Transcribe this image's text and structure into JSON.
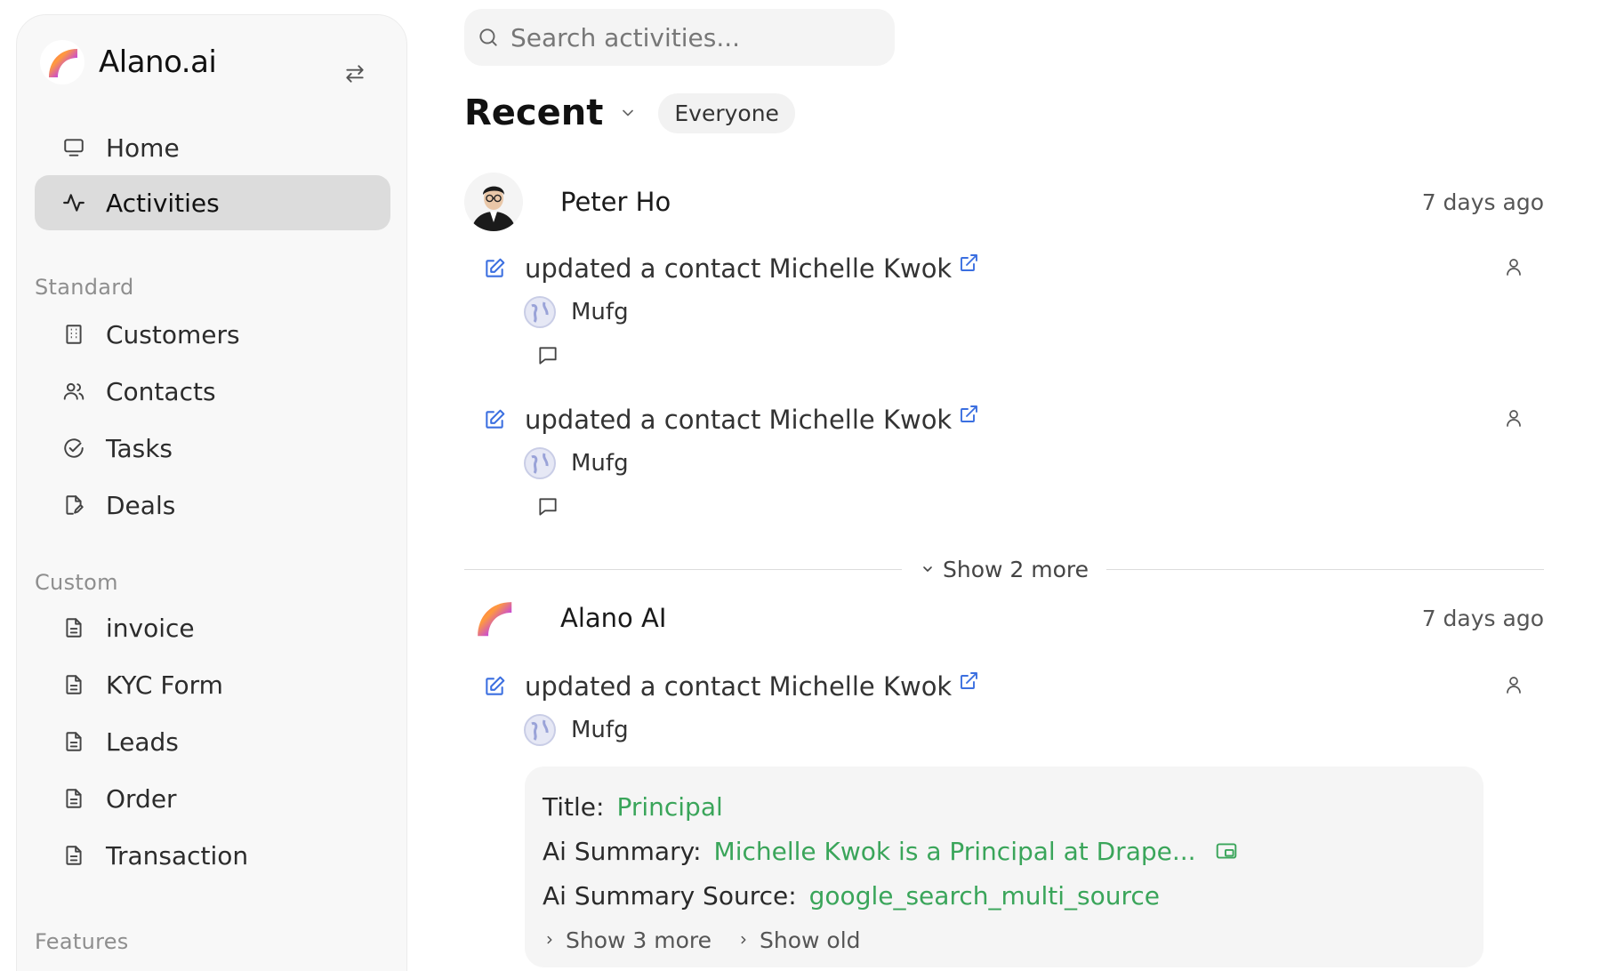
{
  "sidebar": {
    "brand": "Alano.ai",
    "nav": [
      {
        "label": "Home",
        "icon": "monitor-icon"
      },
      {
        "label": "Activities",
        "icon": "activity-icon",
        "active": true
      }
    ],
    "standard_label": "Standard",
    "standard": [
      {
        "label": "Customers",
        "icon": "building-icon"
      },
      {
        "label": "Contacts",
        "icon": "users-icon"
      },
      {
        "label": "Tasks",
        "icon": "check-circle-icon"
      },
      {
        "label": "Deals",
        "icon": "file-edit-icon"
      }
    ],
    "custom_label": "Custom",
    "custom": [
      {
        "label": "invoice",
        "icon": "document-icon"
      },
      {
        "label": "KYC Form",
        "icon": "document-icon"
      },
      {
        "label": "Leads",
        "icon": "document-icon"
      },
      {
        "label": "Order",
        "icon": "document-icon"
      },
      {
        "label": "Transaction",
        "icon": "document-icon"
      }
    ],
    "features_label": "Features"
  },
  "search": {
    "placeholder": "Search activities..."
  },
  "feed": {
    "title": "Recent",
    "filter": "Everyone",
    "groups": [
      {
        "actor": "Peter Ho",
        "time": "7 days ago",
        "activities": [
          {
            "text": "updated a contact Michelle Kwok",
            "company": "Mufg"
          },
          {
            "text": "updated a contact Michelle Kwok",
            "company": "Mufg"
          }
        ],
        "show_more": "Show 2 more"
      },
      {
        "actor": "Alano AI",
        "time": "7 days ago",
        "activities": [
          {
            "text": "updated a contact Michelle Kwok",
            "company": "Mufg",
            "details": [
              {
                "key": "Title:",
                "value": "Principal"
              },
              {
                "key": "Ai Summary:",
                "value": "Michelle Kwok is a Principal at Drape..."
              },
              {
                "key": "Ai Summary Source:",
                "value": "google_search_multi_source"
              }
            ],
            "show_more": "Show 3 more",
            "show_old": "Show old"
          }
        ]
      }
    ]
  },
  "colors": {
    "accent_blue": "#3b6fe0",
    "value_green": "#3aa55a",
    "active_nav": "#dcdcdc"
  }
}
